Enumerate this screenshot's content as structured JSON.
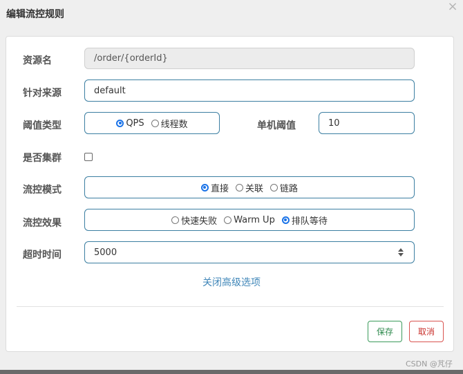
{
  "dialog": {
    "title": "编辑流控规则",
    "close_label": "×"
  },
  "fields": {
    "resource_name": {
      "label": "资源名",
      "value": "/order/{orderId}"
    },
    "limit_app": {
      "label": "针对来源",
      "value": "default"
    },
    "threshold_type": {
      "label": "阈值类型",
      "options": [
        {
          "label": "QPS",
          "selected": true
        },
        {
          "label": "线程数",
          "selected": false
        }
      ]
    },
    "single_threshold": {
      "label": "单机阈值",
      "value": "10"
    },
    "cluster": {
      "label": "是否集群",
      "checked": false
    },
    "flow_mode": {
      "label": "流控模式",
      "options": [
        {
          "label": "直接",
          "selected": true
        },
        {
          "label": "关联",
          "selected": false
        },
        {
          "label": "链路",
          "selected": false
        }
      ]
    },
    "control_behavior": {
      "label": "流控效果",
      "options": [
        {
          "label": "快速失败",
          "selected": false
        },
        {
          "label": "Warm Up",
          "selected": false
        },
        {
          "label": "排队等待",
          "selected": true
        }
      ]
    },
    "timeout": {
      "label": "超时时间",
      "value": "5000"
    }
  },
  "advanced_link": "关闭高级选项",
  "buttons": {
    "save": "保存",
    "cancel": "取消"
  },
  "watermark": "CSDN @芃仔",
  "colors": {
    "accent": "#1a73e8",
    "field_border": "#3b7ea1",
    "save": "#2f8a4e",
    "cancel": "#c9302c",
    "link": "#3f86b8"
  }
}
